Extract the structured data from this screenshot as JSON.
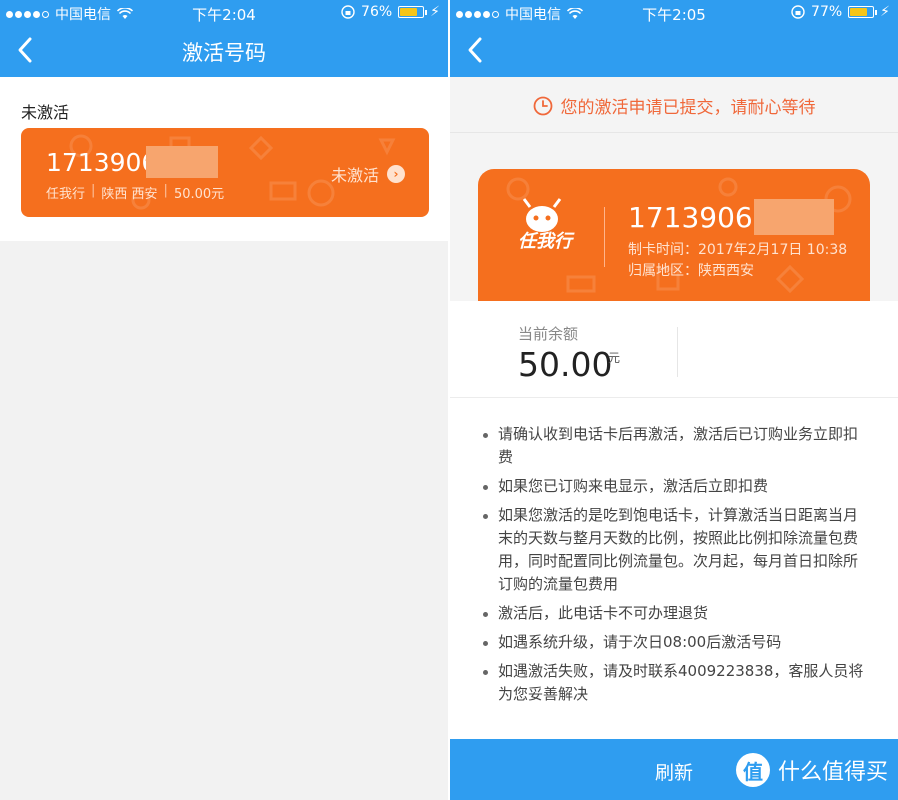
{
  "left": {
    "status": {
      "carrier": "中国电信",
      "time": "下午2:04",
      "battery": "76%",
      "battery_level": 0.76
    },
    "nav": {
      "title": "激活号码"
    },
    "section_label": "未激活",
    "card": {
      "number": "1713906",
      "plan": "任我行",
      "region": "陕西 西安",
      "amount": "50.00元",
      "status": "未激活"
    }
  },
  "right": {
    "status": {
      "carrier": "中国电信",
      "time": "下午2:05",
      "battery": "77%",
      "battery_level": 0.77
    },
    "notice": "您的激活申请已提交，请耐心等待",
    "card": {
      "logo_text": "任我行",
      "number": "1713906",
      "made_time": "制卡时间：2017年2月17日 10:38",
      "region": "归属地区：陕西西安"
    },
    "balance": {
      "label": "当前余额",
      "value": "50.00",
      "unit": "元"
    },
    "notes": [
      "请确认收到电话卡后再激活，激活后已订购业务立即扣费",
      "如果您已订购来电显示，激活后立即扣费",
      "如果您激活的是吃到饱电话卡，计算激活当日距离当月末的天数与整月天数的比例，按照此比例扣除流量包费用，同时配置同比例流量包。次月起，每月首日扣除所订购的流量包费用",
      "激活后，此电话卡不可办理退货",
      "如遇系统升级，请于次日08:00后激活号码",
      "如遇激活失败，请及时联系4009223838，客服人员将为您妥善解决"
    ],
    "refresh": "刷新",
    "watermark": {
      "icon": "值",
      "text": "什么值得买"
    }
  },
  "colors": {
    "accent": "#2f9df0",
    "card": "#f56f1e",
    "notice": "#f0683a",
    "battery": "#f5c518"
  }
}
